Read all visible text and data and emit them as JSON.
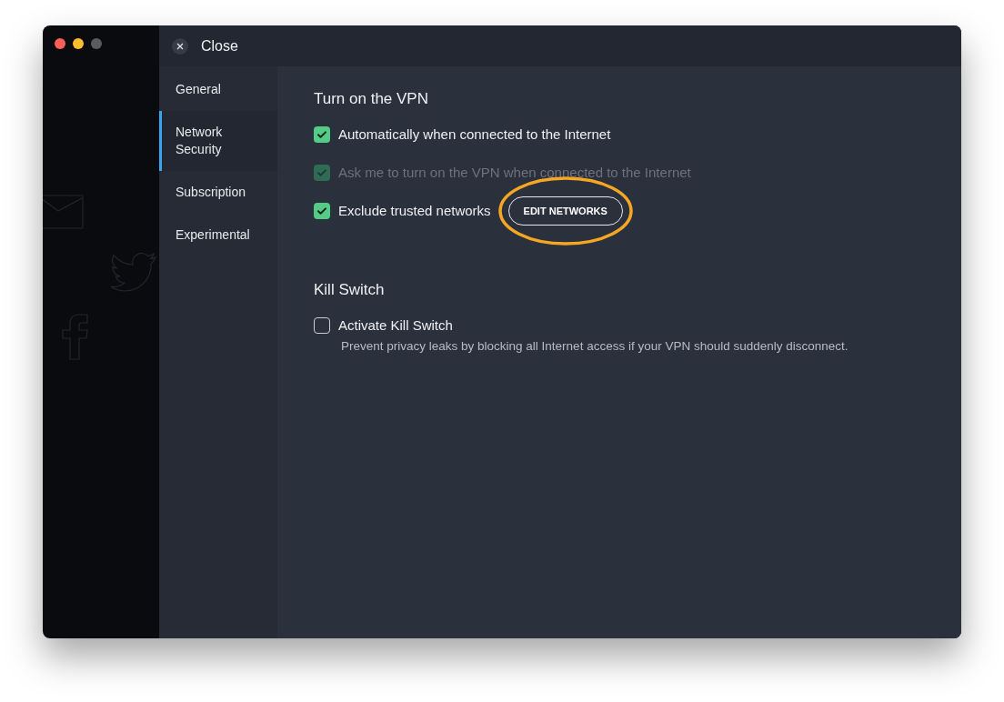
{
  "window": {
    "close_label": "Close"
  },
  "sidebar": {
    "items": [
      {
        "label": "General",
        "selected": false
      },
      {
        "label": "Network\nSecurity",
        "selected": true
      },
      {
        "label": "Subscription",
        "selected": false
      },
      {
        "label": "Experimental",
        "selected": false
      }
    ]
  },
  "sections": [
    {
      "title": "Turn on the VPN",
      "options": [
        {
          "label": "Automatically when connected to the Internet",
          "checked": true,
          "disabled": false
        },
        {
          "label": "Ask me to turn on the VPN when connected to the Internet",
          "checked": true,
          "disabled": true
        },
        {
          "label": "Exclude trusted networks",
          "checked": true,
          "disabled": false,
          "button": "EDIT NETWORKS",
          "highlighted": true
        }
      ]
    },
    {
      "title": "Kill Switch",
      "options": [
        {
          "label": "Activate Kill Switch",
          "checked": false,
          "disabled": false,
          "description": "Prevent privacy leaks by blocking all Internet access if your VPN should suddenly disconnect."
        }
      ]
    }
  ]
}
